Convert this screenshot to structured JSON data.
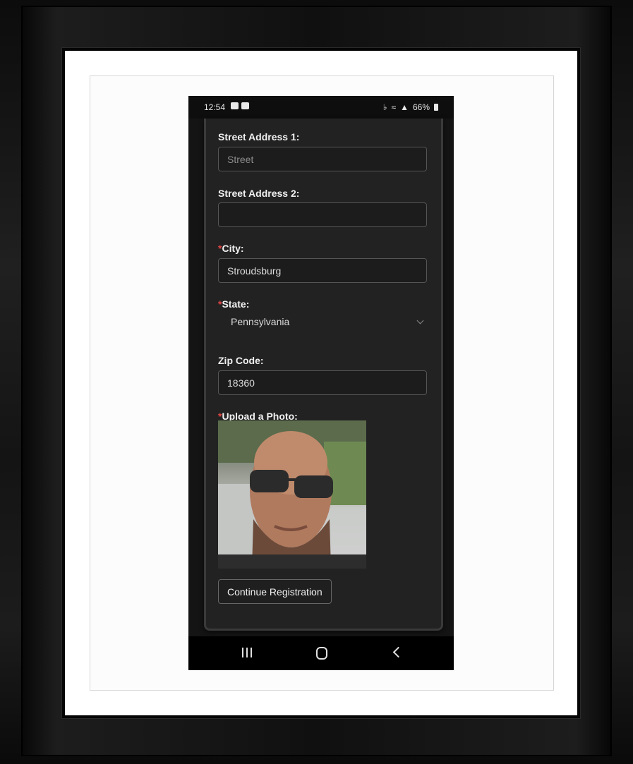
{
  "status_bar": {
    "time": "12:54",
    "battery": "66%",
    "icons": [
      "gallery-icon",
      "youtube-icon",
      "mute-icon",
      "wifi-icon",
      "signal-icon",
      "battery-icon"
    ]
  },
  "form": {
    "street1": {
      "label": "Street Address 1:",
      "value": "",
      "placeholder": "Street"
    },
    "street2": {
      "label": "Street Address 2:",
      "value": ""
    },
    "city": {
      "required_mark": "*",
      "label": "City:",
      "value": "Stroudsburg"
    },
    "state": {
      "required_mark": "*",
      "label": "State:",
      "selected": "Pennsylvania"
    },
    "zip": {
      "label": "Zip Code:",
      "value": "18360"
    },
    "photo": {
      "required_mark": "*",
      "label": "Upload a Photo:"
    },
    "continue_label": "Continue Registration"
  },
  "nav_bar": {
    "icons": [
      "recent-apps-icon",
      "home-icon",
      "back-icon"
    ]
  },
  "colors": {
    "required": "#e04545",
    "card_bg": "#222222",
    "phone_bg": "#141414"
  }
}
